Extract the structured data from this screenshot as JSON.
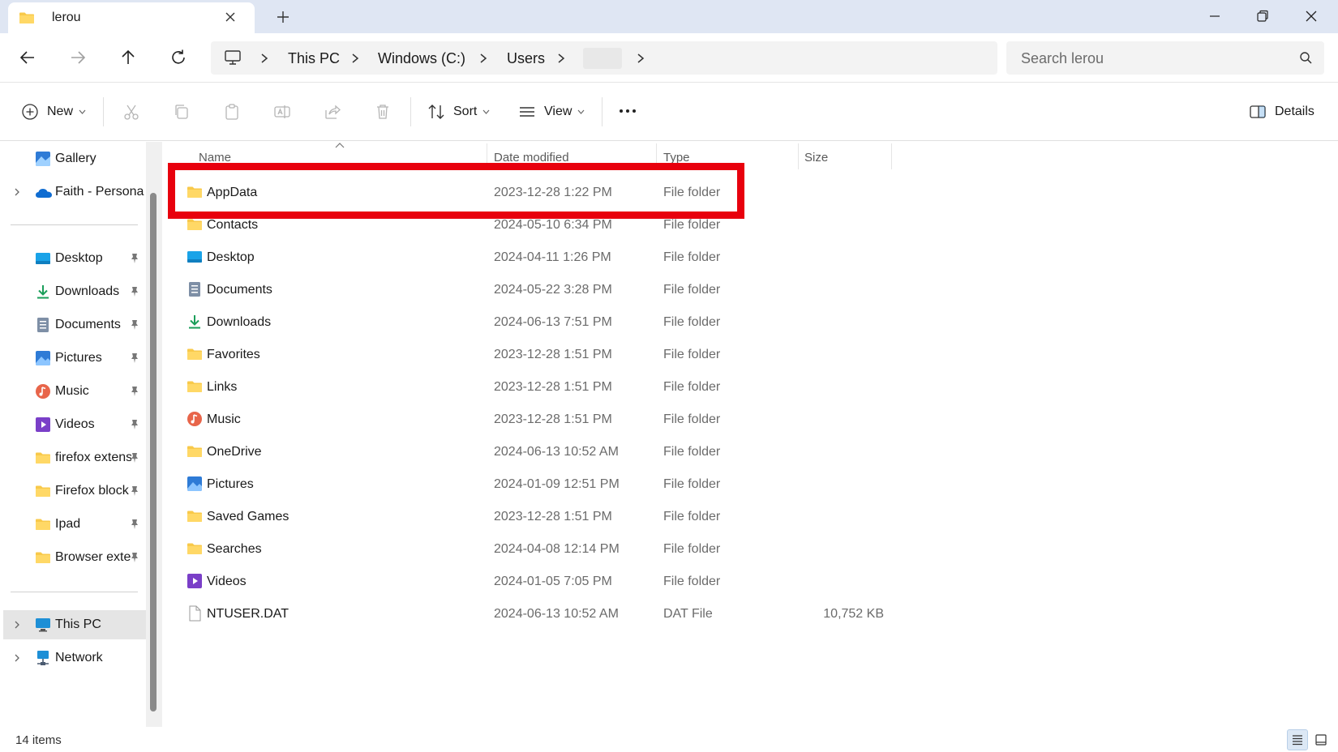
{
  "window": {
    "tab_title": "lerou",
    "tab_icon": "folder-icon",
    "controls": [
      "minimize-icon",
      "restore-icon",
      "close-icon"
    ]
  },
  "nav": {
    "back_icon": "back-arrow-icon",
    "forward_icon": "forward-arrow-icon",
    "up_icon": "up-arrow-icon",
    "refresh_icon": "refresh-icon",
    "breadcrumb": [
      "This PC",
      "Windows (C:)",
      "Users",
      ""
    ],
    "search_placeholder": "Search lerou"
  },
  "toolbar": {
    "new_label": "New",
    "sort_label": "Sort",
    "view_label": "View",
    "details_label": "Details",
    "disabled_actions": [
      "cut-icon",
      "copy-icon",
      "paste-icon",
      "rename-icon",
      "share-icon",
      "delete-icon"
    ]
  },
  "sidebar": {
    "top": [
      {
        "label": "Gallery",
        "icon": "gallery-icon"
      },
      {
        "label": "Faith - Personal",
        "icon": "onedrive-icon"
      }
    ],
    "quick_access": [
      {
        "label": "Desktop",
        "icon": "desktop-icon"
      },
      {
        "label": "Downloads",
        "icon": "downloads-icon"
      },
      {
        "label": "Documents",
        "icon": "documents-icon"
      },
      {
        "label": "Pictures",
        "icon": "pictures-icon"
      },
      {
        "label": "Music",
        "icon": "music-icon"
      },
      {
        "label": "Videos",
        "icon": "videos-icon"
      },
      {
        "label": "firefox extensions",
        "icon": "folder-icon"
      },
      {
        "label": "Firefox block",
        "icon": "folder-icon"
      },
      {
        "label": "Ipad",
        "icon": "folder-icon"
      },
      {
        "label": "Browser extensions",
        "icon": "folder-icon"
      }
    ],
    "bottom": [
      {
        "label": "This PC",
        "icon": "this-pc-icon"
      },
      {
        "label": "Network",
        "icon": "network-icon"
      }
    ]
  },
  "columns": {
    "name": "Name",
    "date": "Date modified",
    "type": "Type",
    "size": "Size"
  },
  "files": [
    {
      "name": "AppData",
      "date": "2023-12-28 1:22 PM",
      "type": "File folder",
      "size": "",
      "icon": "folder-icon"
    },
    {
      "name": "Contacts",
      "date": "2024-05-10 6:34 PM",
      "type": "File folder",
      "size": "",
      "icon": "folder-icon"
    },
    {
      "name": "Desktop",
      "date": "2024-04-11 1:26 PM",
      "type": "File folder",
      "size": "",
      "icon": "desktop-icon"
    },
    {
      "name": "Documents",
      "date": "2024-05-22 3:28 PM",
      "type": "File folder",
      "size": "",
      "icon": "documents-icon"
    },
    {
      "name": "Downloads",
      "date": "2024-06-13 7:51 PM",
      "type": "File folder",
      "size": "",
      "icon": "downloads-icon"
    },
    {
      "name": "Favorites",
      "date": "2023-12-28 1:51 PM",
      "type": "File folder",
      "size": "",
      "icon": "folder-icon"
    },
    {
      "name": "Links",
      "date": "2023-12-28 1:51 PM",
      "type": "File folder",
      "size": "",
      "icon": "folder-icon"
    },
    {
      "name": "Music",
      "date": "2023-12-28 1:51 PM",
      "type": "File folder",
      "size": "",
      "icon": "music-icon"
    },
    {
      "name": "OneDrive",
      "date": "2024-06-13 10:52 AM",
      "type": "File folder",
      "size": "",
      "icon": "folder-icon"
    },
    {
      "name": "Pictures",
      "date": "2024-01-09 12:51 PM",
      "type": "File folder",
      "size": "",
      "icon": "pictures-icon"
    },
    {
      "name": "Saved Games",
      "date": "2023-12-28 1:51 PM",
      "type": "File folder",
      "size": "",
      "icon": "folder-icon"
    },
    {
      "name": "Searches",
      "date": "2024-04-08 12:14 PM",
      "type": "File folder",
      "size": "",
      "icon": "folder-icon"
    },
    {
      "name": "Videos",
      "date": "2024-01-05 7:05 PM",
      "type": "File folder",
      "size": "",
      "icon": "videos-icon"
    },
    {
      "name": "NTUSER.DAT",
      "date": "2024-06-13 10:52 AM",
      "type": "DAT File",
      "size": "10,752 KB",
      "icon": "file-icon"
    }
  ],
  "status": {
    "item_count": "14 items"
  },
  "colors": {
    "highlight": "#e8000d",
    "folder": "#f8c94a",
    "titlebar": "#dfe6f3"
  }
}
